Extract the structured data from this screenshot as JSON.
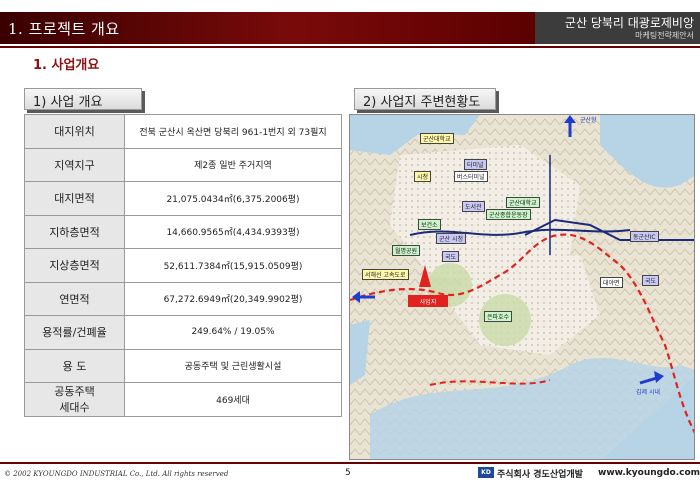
{
  "header": {
    "title": "1. 프로젝트 개요",
    "project_name": "군산 당북리 대광로제비앙",
    "doc_type": "마케팅전략제안서"
  },
  "section_title": "1. 사업개요",
  "left_box": {
    "label": "1) 사업 개요"
  },
  "right_box": {
    "label": "2) 사업지 주변현황도"
  },
  "table": {
    "rows": [
      {
        "key": "대지위치",
        "value": "전북 군산시 옥산면 당북리 961-1번지 외 73필지"
      },
      {
        "key": "지역지구",
        "value": "제2종 일반 주거지역"
      },
      {
        "key": "대지면적",
        "value": "21,075.0434㎡(6,375.2006평)"
      },
      {
        "key": "지하층면적",
        "value": "14,660.9565㎡(4,434.9393평)"
      },
      {
        "key": "지상층면적",
        "value": "52,611.7384㎡(15,915.0509평)"
      },
      {
        "key": "연면적",
        "value": "67,272.6949㎡(20,349.9902평)"
      },
      {
        "key": "용적률/건폐율",
        "value": "249.64% / 19.05%"
      },
      {
        "key": "용     도",
        "value": "공동주택 및 근린생활시설"
      },
      {
        "key": "공동주택\n세대수",
        "value": "469세대"
      }
    ]
  },
  "map": {
    "labels": {
      "gunsan_station": "군산대학교",
      "city_hall": "시청",
      "terminal": "터미널",
      "bus_terminal": "버스터미널",
      "gunsan_stadium": "군산종합운동장",
      "health": "보건소",
      "gunsan_univ": "군산대학교",
      "library": "도서관",
      "park": "월명공원",
      "site": "사업지",
      "jijong": "군산 시청",
      "office": "대야면",
      "tram": "국도",
      "lake": "은파호수",
      "west": "서해선 고속도로",
      "east": "동군산IC",
      "top_road": "군산항",
      "bottom_road": "김제 시내"
    }
  },
  "footer": {
    "copyright": "© 2002 KYOUNGDO INDUSTRIAL Co., Ltd. All rights reserved",
    "page": "5",
    "logo": "KD",
    "company": "주식회사 경도산업개발",
    "url": "www.kyoungdo.com"
  }
}
